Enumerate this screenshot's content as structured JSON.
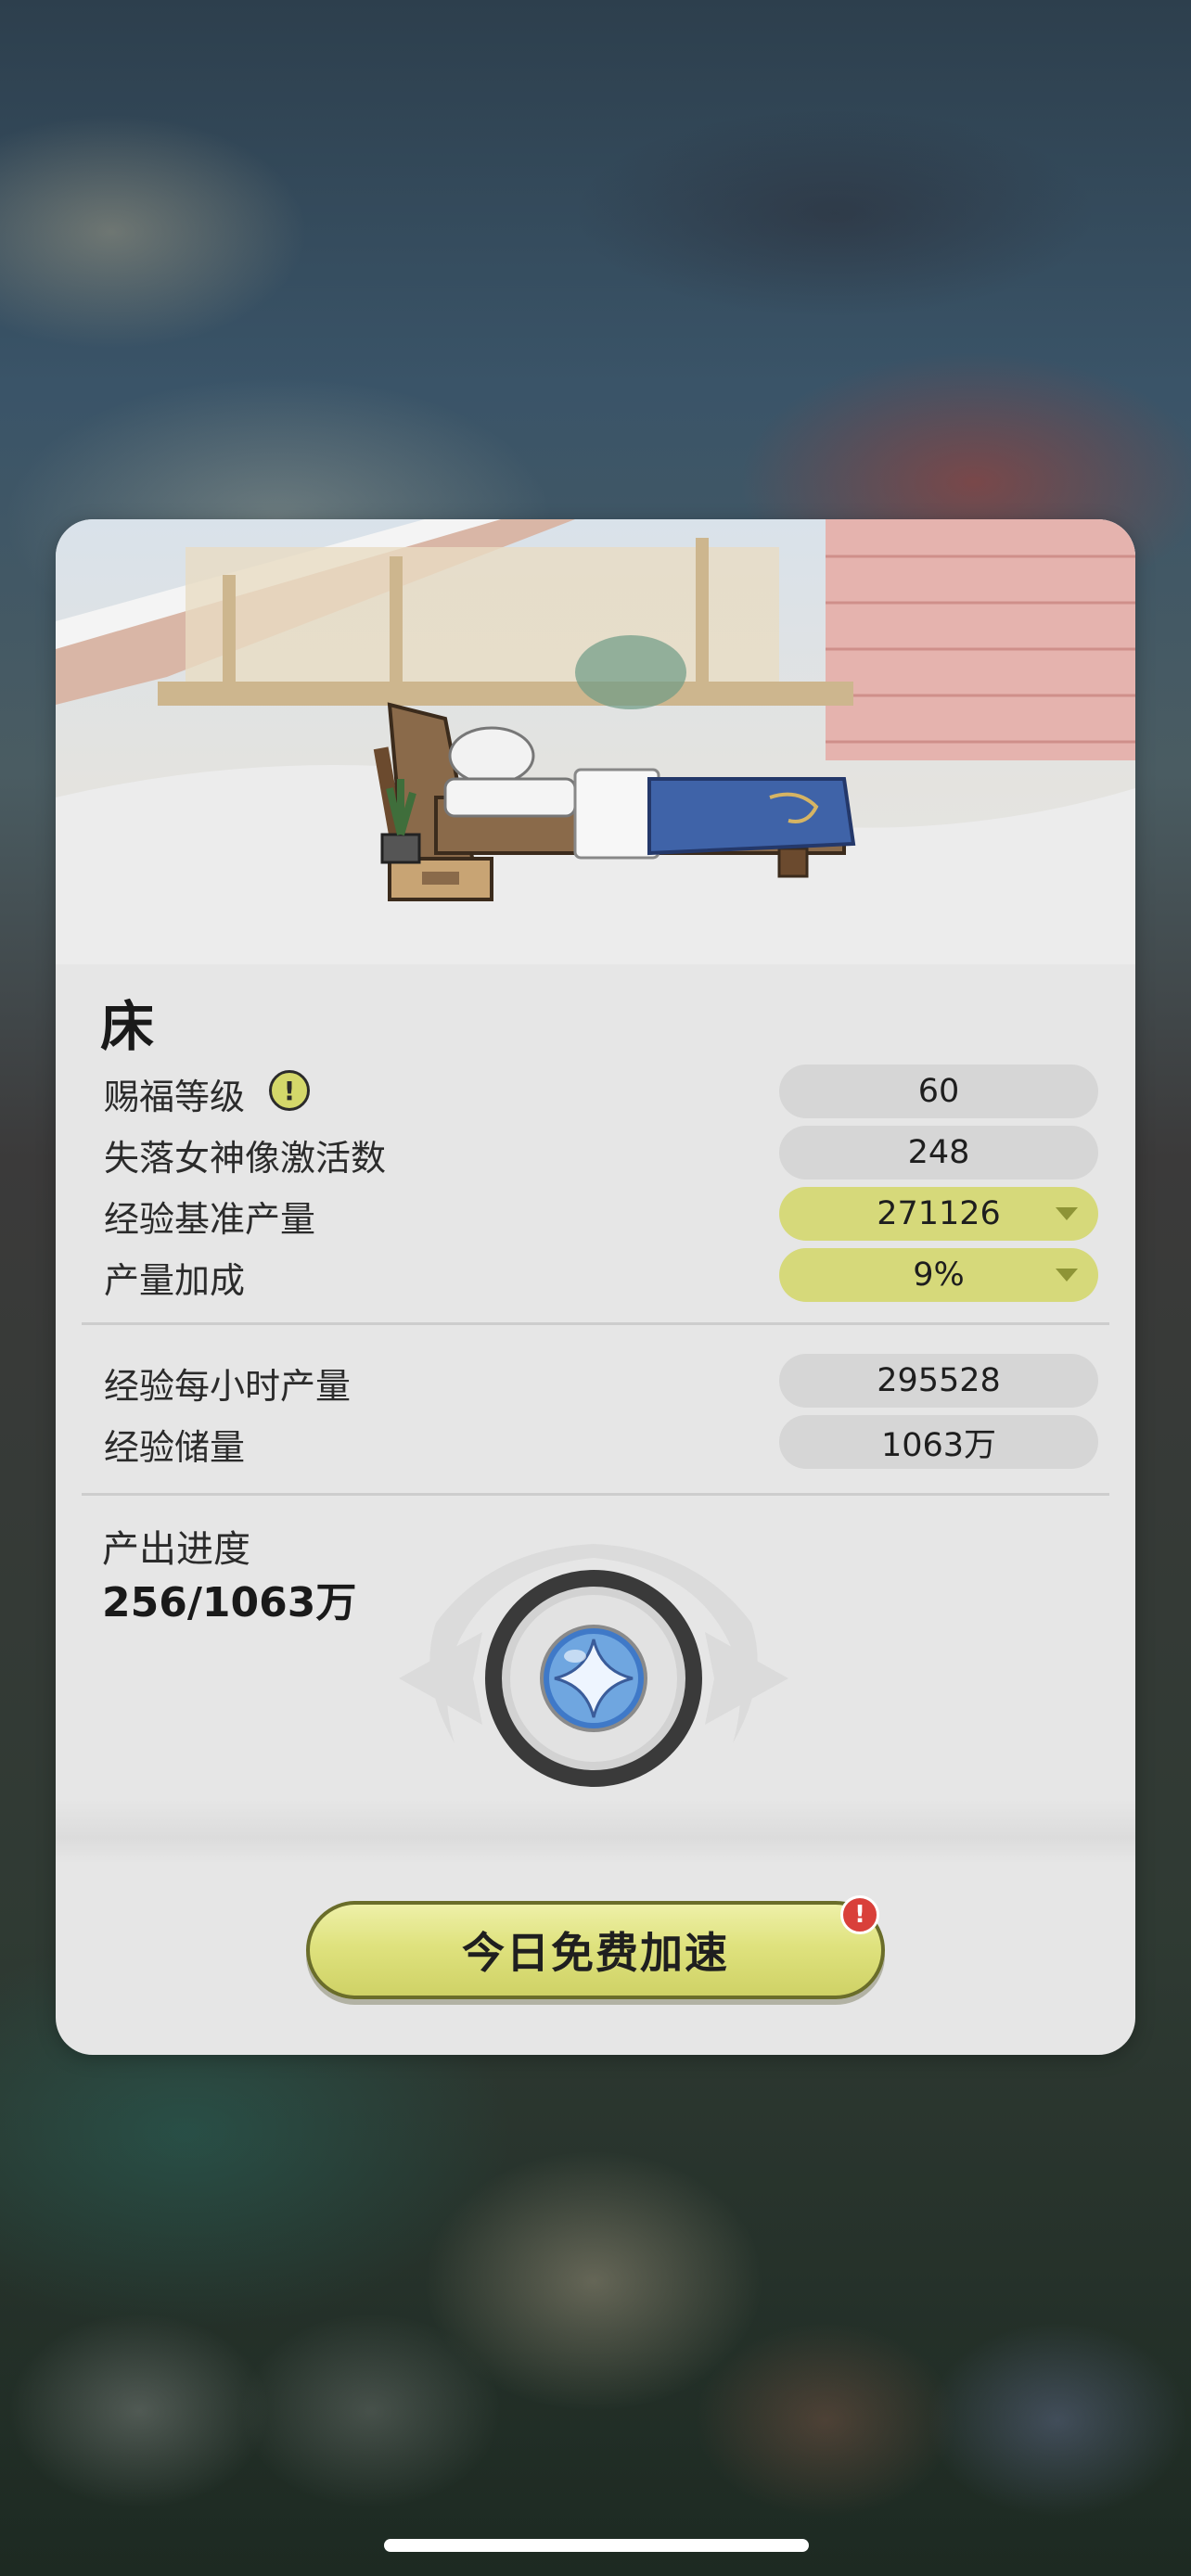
{
  "item": {
    "name": "床"
  },
  "stats": [
    {
      "label": "赐福等级",
      "value": "60",
      "has_info_icon": true,
      "dropdown": false
    },
    {
      "label": "失落女神像激活数",
      "value": "248",
      "dropdown": false
    },
    {
      "label": "经验基准产量",
      "value": "271126",
      "dropdown": true
    },
    {
      "label": "产量加成",
      "value": "9%",
      "dropdown": true
    }
  ],
  "output": [
    {
      "label": "经验每小时产量",
      "value": "295528"
    },
    {
      "label": "经验储量",
      "value": "1063万"
    }
  ],
  "progress": {
    "label": "产出进度",
    "value_text": "256/1063万",
    "current": 256,
    "max": 10630000
  },
  "action": {
    "label": "今日免费加速",
    "alert_glyph": "!"
  },
  "icons": {
    "info": "exclamation-circle-icon",
    "dropdown": "triangle-down-icon",
    "orb": "star-orb-icon",
    "alert": "alert-badge-icon"
  },
  "colors": {
    "card_bg": "#e6e6e6",
    "pill_gray": "#d6d6d6",
    "pill_yellow": "#d6d97a",
    "button_yellow": "#dfe27e",
    "alert_red": "#d9403a"
  }
}
